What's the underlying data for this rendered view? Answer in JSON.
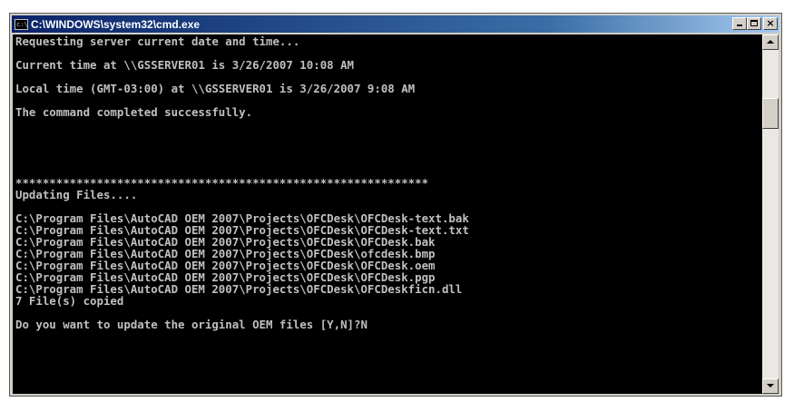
{
  "window": {
    "title": "C:\\WINDOWS\\system32\\cmd.exe",
    "icon": "cmd-icon",
    "title_icon_glyph": "c:\\",
    "buttons": {
      "minimize": "minimize-icon",
      "maximize": "maximize-icon",
      "close": "close-icon",
      "close_glyph": "×"
    }
  },
  "console": {
    "text_color": "#c0c0c0",
    "background": "#000000",
    "lines": [
      "Requesting server current date and time...",
      "",
      "Current time at \\\\GSSERVER01 is 3/26/2007 10:08 AM",
      "",
      "Local time (GMT-03:00) at \\\\GSSERVER01 is 3/26/2007 9:08 AM",
      "",
      "The command completed successfully.",
      "",
      "",
      "",
      "",
      "",
      "*************************************************************",
      "Updating Files....",
      "",
      "C:\\Program Files\\AutoCAD OEM 2007\\Projects\\OFCDesk\\OFCDesk-text.bak",
      "C:\\Program Files\\AutoCAD OEM 2007\\Projects\\OFCDesk\\OFCDesk-text.txt",
      "C:\\Program Files\\AutoCAD OEM 2007\\Projects\\OFCDesk\\OFCDesk.bak",
      "C:\\Program Files\\AutoCAD OEM 2007\\Projects\\OFCDesk\\ofcdesk.bmp",
      "C:\\Program Files\\AutoCAD OEM 2007\\Projects\\OFCDesk\\OFCDesk.oem",
      "C:\\Program Files\\AutoCAD OEM 2007\\Projects\\OFCDesk\\OFCDesk.pgp",
      "C:\\Program Files\\AutoCAD OEM 2007\\Projects\\OFCDesk\\OFCDeskficn.dll",
      "7 File(s) copied",
      "",
      "Do you want to update the original OEM files [Y,N]?N"
    ]
  },
  "scrollbar": {
    "up": "scroll-up-arrow-icon",
    "down": "scroll-down-arrow-icon"
  }
}
